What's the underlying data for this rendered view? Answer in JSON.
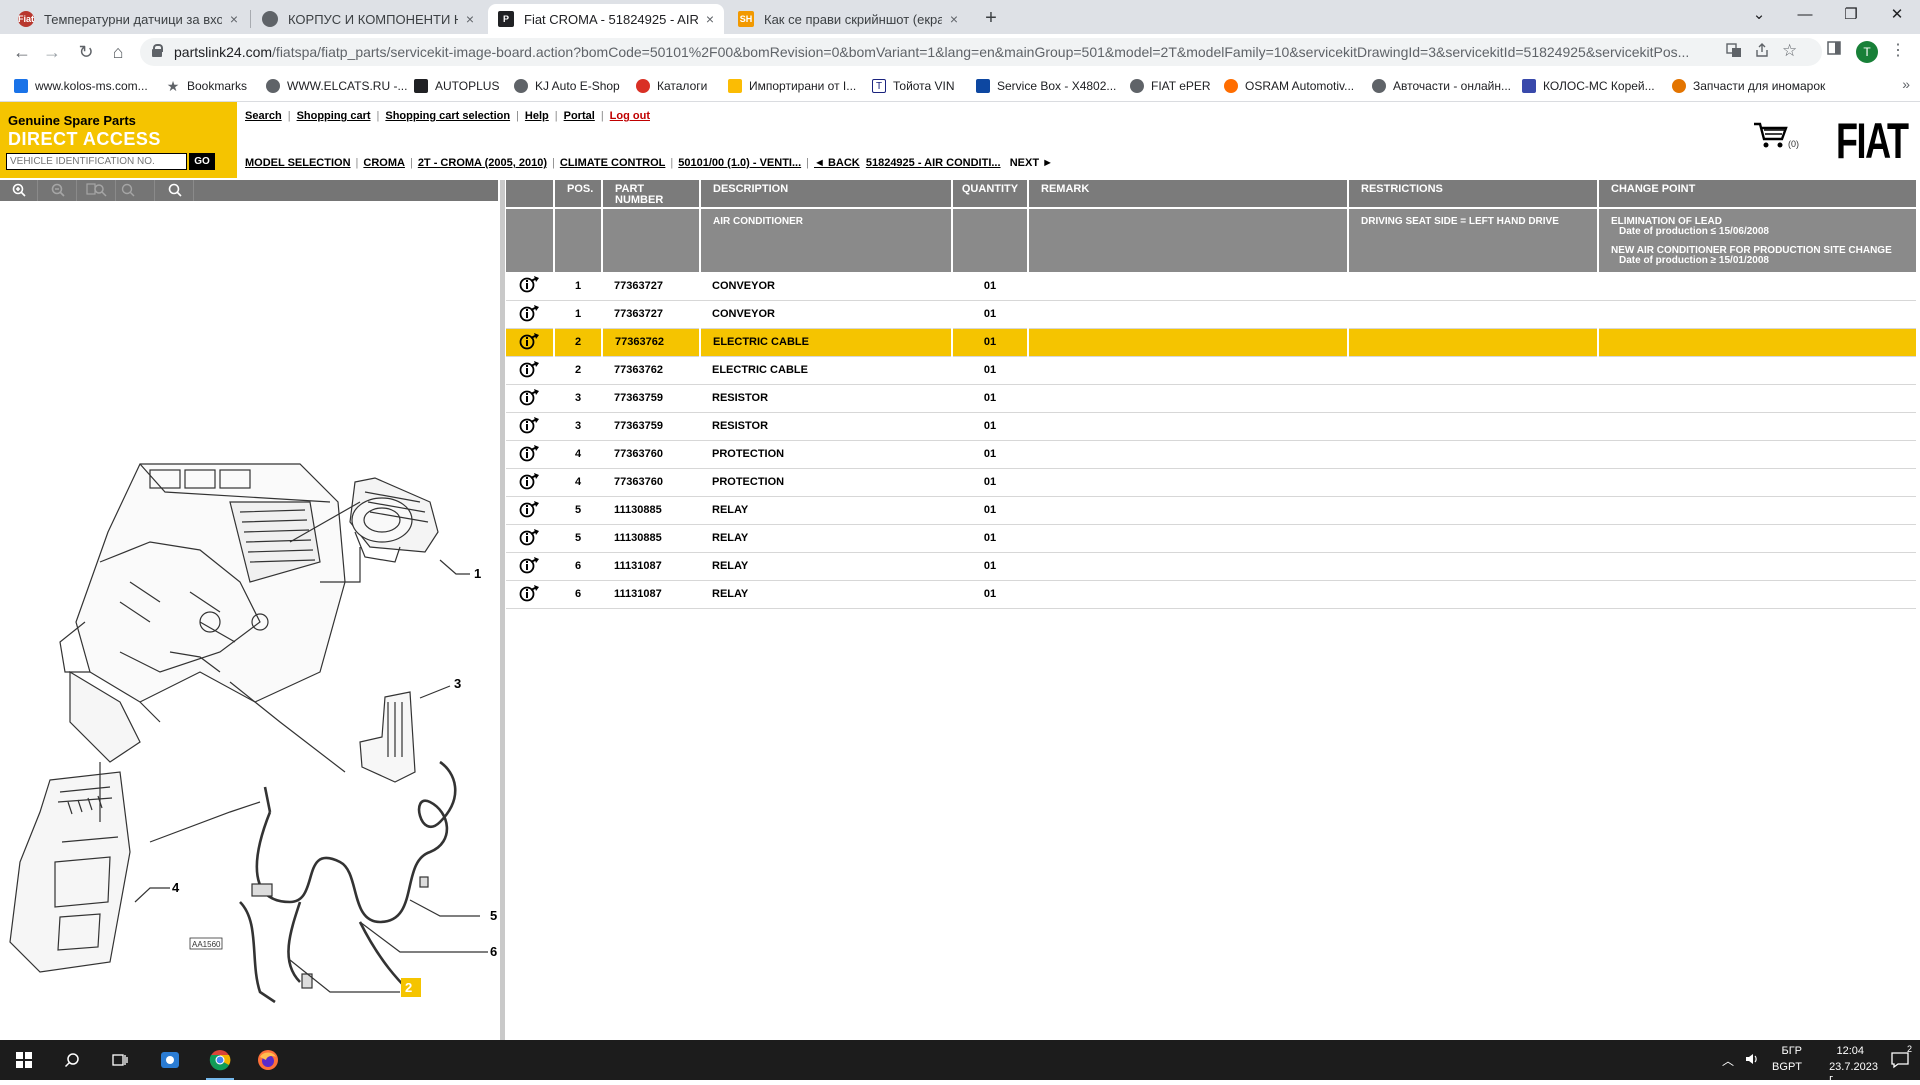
{
  "browser": {
    "tabs": [
      {
        "title": "Температурни датчици за входя...",
        "close": "×",
        "favicon_color": "#b8372e",
        "favicon_text": "Fiat"
      },
      {
        "title": "КОРПУС И КОМПОНЕНТИ НА КЛ...",
        "close": "×",
        "favicon_color": "#5f6368",
        "favicon_text": ""
      },
      {
        "title": "Fiat CROMA - 51824925 - AIR CO...",
        "close": "×",
        "favicon_color": "#202124",
        "favicon_text": "P"
      },
      {
        "title": "Как се прави скрийншот (екран...",
        "close": "×",
        "favicon_color": "#f29900",
        "favicon_text": "SH"
      }
    ],
    "new_tab": "+",
    "window_buttons": [
      "⌄",
      "—",
      "❐",
      "✕"
    ],
    "nav": {
      "back": "←",
      "forward": "→",
      "reload": "↻",
      "home": "⌂"
    },
    "url_host": "partslink24.com",
    "url_path": "/fiatspa/fiatp_parts/servicekit-image-board.action?bomCode=50101%2F00&bomRevision=0&bomVariant=1&lang=en&mainGroup=501&model=2T&modelFamily=10&servicekitDrawingId=3&servicekitId=51824925&servicekitPos...",
    "avatar_letter": "T",
    "bookmarks": [
      {
        "label": "www.kolos-ms.com...",
        "color": "#1a73e8"
      },
      {
        "label": "Bookmarks",
        "color": "#5f6368",
        "glyph": "★"
      },
      {
        "label": "WWW.ELCATS.RU -...",
        "color": "#5f6368"
      },
      {
        "label": "AUTOPLUS",
        "color": "#202124"
      },
      {
        "label": "KJ Auto E-Shop",
        "color": "#5f6368"
      },
      {
        "label": "Каталоги",
        "color": "#d93025"
      },
      {
        "label": "Импортирани от I...",
        "color": "#fbbc04"
      },
      {
        "label": "Тойота VIN",
        "color": "#1a237e"
      },
      {
        "label": "Service Box - X4802...",
        "color": "#0d47a1"
      },
      {
        "label": "FIAT ePER",
        "color": "#5f6368"
      },
      {
        "label": "OSRAM Automotiv...",
        "color": "#ff6d00"
      },
      {
        "label": "Авточасти - онлайн...",
        "color": "#5f6368"
      },
      {
        "label": "КОЛОС-МС Корей...",
        "color": "#3949ab"
      },
      {
        "label": "Запчасти для иномарок",
        "color": "#e37400"
      }
    ],
    "bookmarks_more": "»"
  },
  "header": {
    "brand_line1": "Genuine Spare Parts",
    "brand_line2": "DIRECT ACCESS",
    "vin_placeholder": "VEHICLE IDENTIFICATION NO.",
    "go_label": "GO",
    "menu": [
      "Search",
      "Shopping cart",
      "Shopping cart selection",
      "Help",
      "Portal",
      "Log out"
    ],
    "breadcrumbs": [
      "MODEL SELECTION",
      "CROMA",
      "2T - CROMA (2005, 2010)",
      "CLIMATE CONTROL",
      "50101/00 (1.0) - VENTI...",
      "◄ BACK",
      "51824925 - AIR CONDITI...",
      "NEXT ►"
    ],
    "cart_count": "(0)",
    "logo": "FIAT"
  },
  "viewer": {
    "tools": [
      "zoom-in",
      "zoom-out",
      "zoom-fit",
      "zoom-100",
      "zoom-area"
    ],
    "tool_glyph_fit": "⊡",
    "tool_glyph_100": "100%",
    "labels": [
      "1",
      "2",
      "3",
      "4",
      "5",
      "6"
    ],
    "drawing_code": "AA1560"
  },
  "table": {
    "columns": [
      "POS.",
      "PART NUMBER",
      "DESCRIPTION",
      "QUANTITY",
      "REMARK",
      "RESTRICTIONS",
      "CHANGE POINT"
    ],
    "group": {
      "description": "AIR CONDITIONER",
      "restriction": "DRIVING SEAT SIDE = LEFT HAND DRIVE",
      "change1": "ELIMINATION OF LEAD",
      "change1_date": "Date of production ≤ 15/06/2008",
      "change2": "NEW AIR CONDITIONER FOR PRODUCTION SITE CHANGE",
      "change2_date": "Date of production ≥ 15/01/2008"
    },
    "rows": [
      {
        "pos": "1",
        "part": "77363727",
        "desc": "CONVEYOR",
        "qty": "01"
      },
      {
        "pos": "1",
        "part": "77363727",
        "desc": "CONVEYOR",
        "qty": "01"
      },
      {
        "pos": "2",
        "part": "77363762",
        "desc": "ELECTRIC CABLE",
        "qty": "01"
      },
      {
        "pos": "2",
        "part": "77363762",
        "desc": "ELECTRIC CABLE",
        "qty": "01"
      },
      {
        "pos": "3",
        "part": "77363759",
        "desc": "RESISTOR",
        "qty": "01"
      },
      {
        "pos": "3",
        "part": "77363759",
        "desc": "RESISTOR",
        "qty": "01"
      },
      {
        "pos": "4",
        "part": "77363760",
        "desc": "PROTECTION",
        "qty": "01"
      },
      {
        "pos": "4",
        "part": "77363760",
        "desc": "PROTECTION",
        "qty": "01"
      },
      {
        "pos": "5",
        "part": "11130885",
        "desc": "RELAY",
        "qty": "01"
      },
      {
        "pos": "5",
        "part": "11130885",
        "desc": "RELAY",
        "qty": "01"
      },
      {
        "pos": "6",
        "part": "11131087",
        "desc": "RELAY",
        "qty": "01"
      },
      {
        "pos": "6",
        "part": "11131087",
        "desc": "RELAY",
        "qty": "01"
      }
    ],
    "selected_row": 2,
    "highlight_color": "#f5c400"
  },
  "taskbar": {
    "lang": "БГР",
    "lang2": "BGPT",
    "time": "12:04",
    "date": "23.7.2023 г.",
    "notif_count": "2"
  }
}
